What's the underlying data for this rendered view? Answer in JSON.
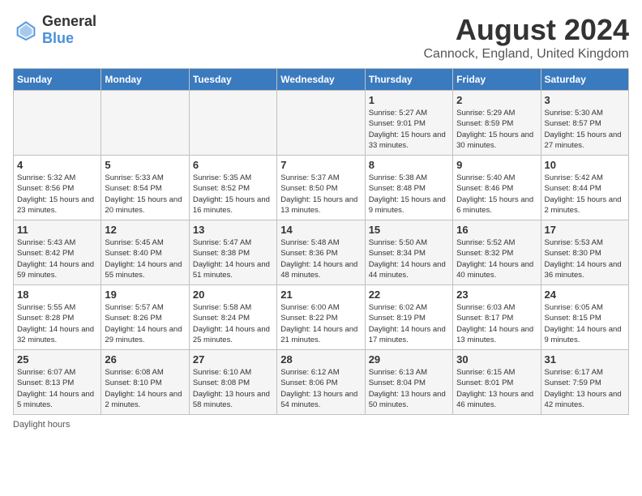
{
  "header": {
    "logo_general": "General",
    "logo_blue": "Blue",
    "month": "August 2024",
    "location": "Cannock, England, United Kingdom"
  },
  "weekdays": [
    "Sunday",
    "Monday",
    "Tuesday",
    "Wednesday",
    "Thursday",
    "Friday",
    "Saturday"
  ],
  "footer": "Daylight hours",
  "weeks": [
    [
      {
        "day": "",
        "info": ""
      },
      {
        "day": "",
        "info": ""
      },
      {
        "day": "",
        "info": ""
      },
      {
        "day": "",
        "info": ""
      },
      {
        "day": "1",
        "info": "Sunrise: 5:27 AM\nSunset: 9:01 PM\nDaylight: 15 hours\nand 33 minutes."
      },
      {
        "day": "2",
        "info": "Sunrise: 5:29 AM\nSunset: 8:59 PM\nDaylight: 15 hours\nand 30 minutes."
      },
      {
        "day": "3",
        "info": "Sunrise: 5:30 AM\nSunset: 8:57 PM\nDaylight: 15 hours\nand 27 minutes."
      }
    ],
    [
      {
        "day": "4",
        "info": "Sunrise: 5:32 AM\nSunset: 8:56 PM\nDaylight: 15 hours\nand 23 minutes."
      },
      {
        "day": "5",
        "info": "Sunrise: 5:33 AM\nSunset: 8:54 PM\nDaylight: 15 hours\nand 20 minutes."
      },
      {
        "day": "6",
        "info": "Sunrise: 5:35 AM\nSunset: 8:52 PM\nDaylight: 15 hours\nand 16 minutes."
      },
      {
        "day": "7",
        "info": "Sunrise: 5:37 AM\nSunset: 8:50 PM\nDaylight: 15 hours\nand 13 minutes."
      },
      {
        "day": "8",
        "info": "Sunrise: 5:38 AM\nSunset: 8:48 PM\nDaylight: 15 hours\nand 9 minutes."
      },
      {
        "day": "9",
        "info": "Sunrise: 5:40 AM\nSunset: 8:46 PM\nDaylight: 15 hours\nand 6 minutes."
      },
      {
        "day": "10",
        "info": "Sunrise: 5:42 AM\nSunset: 8:44 PM\nDaylight: 15 hours\nand 2 minutes."
      }
    ],
    [
      {
        "day": "11",
        "info": "Sunrise: 5:43 AM\nSunset: 8:42 PM\nDaylight: 14 hours\nand 59 minutes."
      },
      {
        "day": "12",
        "info": "Sunrise: 5:45 AM\nSunset: 8:40 PM\nDaylight: 14 hours\nand 55 minutes."
      },
      {
        "day": "13",
        "info": "Sunrise: 5:47 AM\nSunset: 8:38 PM\nDaylight: 14 hours\nand 51 minutes."
      },
      {
        "day": "14",
        "info": "Sunrise: 5:48 AM\nSunset: 8:36 PM\nDaylight: 14 hours\nand 48 minutes."
      },
      {
        "day": "15",
        "info": "Sunrise: 5:50 AM\nSunset: 8:34 PM\nDaylight: 14 hours\nand 44 minutes."
      },
      {
        "day": "16",
        "info": "Sunrise: 5:52 AM\nSunset: 8:32 PM\nDaylight: 14 hours\nand 40 minutes."
      },
      {
        "day": "17",
        "info": "Sunrise: 5:53 AM\nSunset: 8:30 PM\nDaylight: 14 hours\nand 36 minutes."
      }
    ],
    [
      {
        "day": "18",
        "info": "Sunrise: 5:55 AM\nSunset: 8:28 PM\nDaylight: 14 hours\nand 32 minutes."
      },
      {
        "day": "19",
        "info": "Sunrise: 5:57 AM\nSunset: 8:26 PM\nDaylight: 14 hours\nand 29 minutes."
      },
      {
        "day": "20",
        "info": "Sunrise: 5:58 AM\nSunset: 8:24 PM\nDaylight: 14 hours\nand 25 minutes."
      },
      {
        "day": "21",
        "info": "Sunrise: 6:00 AM\nSunset: 8:22 PM\nDaylight: 14 hours\nand 21 minutes."
      },
      {
        "day": "22",
        "info": "Sunrise: 6:02 AM\nSunset: 8:19 PM\nDaylight: 14 hours\nand 17 minutes."
      },
      {
        "day": "23",
        "info": "Sunrise: 6:03 AM\nSunset: 8:17 PM\nDaylight: 14 hours\nand 13 minutes."
      },
      {
        "day": "24",
        "info": "Sunrise: 6:05 AM\nSunset: 8:15 PM\nDaylight: 14 hours\nand 9 minutes."
      }
    ],
    [
      {
        "day": "25",
        "info": "Sunrise: 6:07 AM\nSunset: 8:13 PM\nDaylight: 14 hours\nand 5 minutes."
      },
      {
        "day": "26",
        "info": "Sunrise: 6:08 AM\nSunset: 8:10 PM\nDaylight: 14 hours\nand 2 minutes."
      },
      {
        "day": "27",
        "info": "Sunrise: 6:10 AM\nSunset: 8:08 PM\nDaylight: 13 hours\nand 58 minutes."
      },
      {
        "day": "28",
        "info": "Sunrise: 6:12 AM\nSunset: 8:06 PM\nDaylight: 13 hours\nand 54 minutes."
      },
      {
        "day": "29",
        "info": "Sunrise: 6:13 AM\nSunset: 8:04 PM\nDaylight: 13 hours\nand 50 minutes."
      },
      {
        "day": "30",
        "info": "Sunrise: 6:15 AM\nSunset: 8:01 PM\nDaylight: 13 hours\nand 46 minutes."
      },
      {
        "day": "31",
        "info": "Sunrise: 6:17 AM\nSunset: 7:59 PM\nDaylight: 13 hours\nand 42 minutes."
      }
    ]
  ]
}
